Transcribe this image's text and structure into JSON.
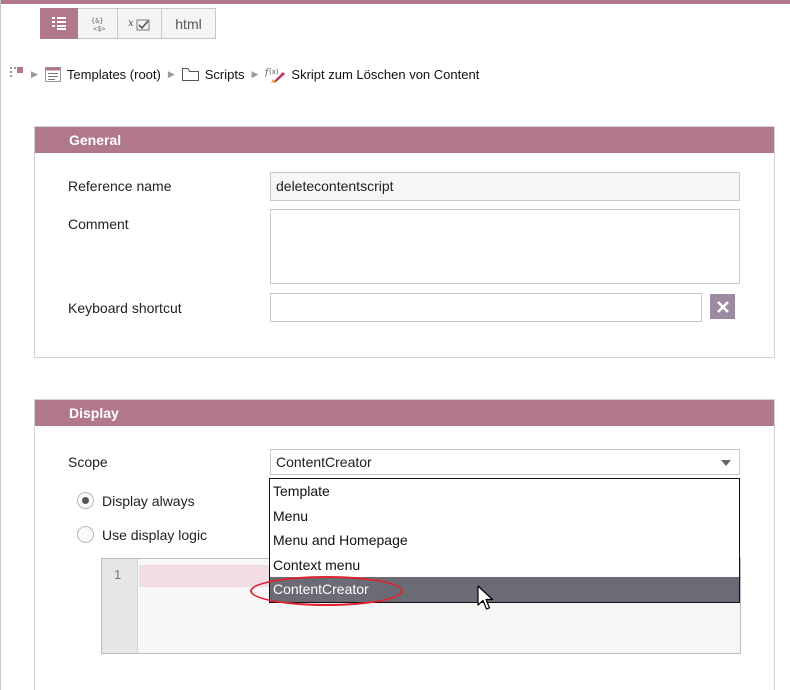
{
  "toolbar": {
    "tabs": [
      {
        "icon": "form-view-icon",
        "active": true
      },
      {
        "icon": "script-code-icon",
        "active": false
      },
      {
        "icon": "checkbox-variable-icon",
        "active": false
      },
      {
        "label": "html",
        "active": false
      }
    ]
  },
  "breadcrumb": {
    "items": [
      {
        "label": "Templates (root)",
        "icon": "templates-list-icon"
      },
      {
        "label": "Scripts",
        "icon": "folder-icon"
      },
      {
        "label": "Skript zum Löschen von Content",
        "icon": "script-fx-icon"
      }
    ]
  },
  "general": {
    "title": "General",
    "reference_name_label": "Reference name",
    "reference_name_value": "deletecontentscript",
    "comment_label": "Comment",
    "comment_value": "",
    "shortcut_label": "Keyboard shortcut",
    "shortcut_value": ""
  },
  "display": {
    "title": "Display",
    "scope_label": "Scope",
    "scope_value": "ContentCreator",
    "radio_always": "Display always",
    "radio_logic": "Use display logic",
    "radio_selected": "Display always",
    "editor_line_number": "1",
    "dropdown_options": [
      "Template",
      "Menu",
      "Menu and Homepage",
      "Context menu",
      "ContentCreator"
    ],
    "dropdown_selected_index": 4
  },
  "colors": {
    "accent": "#b07888",
    "clear_button": "#9b8aa1",
    "selected_option": "#6a6b74",
    "annotation": "#e0212e"
  }
}
